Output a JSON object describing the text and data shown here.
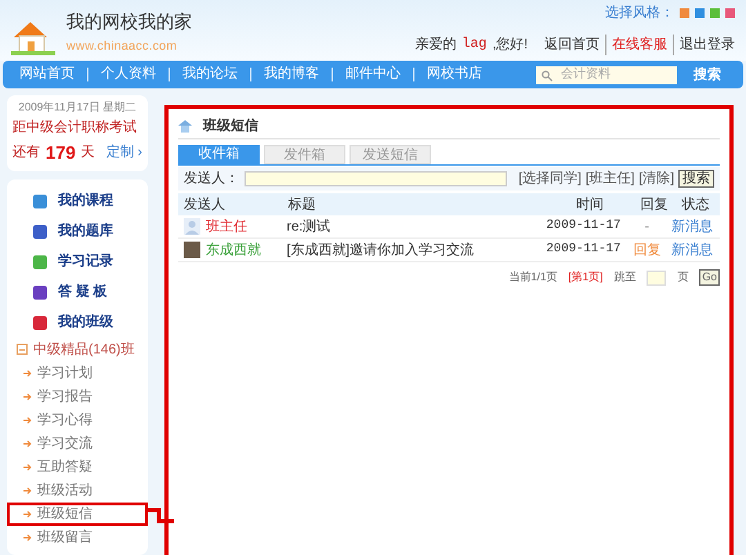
{
  "header": {
    "logo_title": "我的网校我的家",
    "logo_url": "www.chinaacc.com",
    "style_label": "选择风格：",
    "styles": [
      {
        "color": "#f08a3c",
        "selected": false
      },
      {
        "color": "#2f8fe0",
        "selected": false
      },
      {
        "color": "#5bbf3a",
        "selected": false
      },
      {
        "color": "#e8587a",
        "selected": false
      }
    ],
    "greeting_prefix": "亲爱的",
    "user": "lag",
    "greeting_suffix": ",您好!",
    "links": [
      {
        "label": "返回首页",
        "kind": "normal"
      },
      {
        "label": "在线客服",
        "kind": "hot"
      },
      {
        "label": "退出登录",
        "kind": "normal"
      }
    ]
  },
  "nav": {
    "items": [
      "网站首页",
      "个人资料",
      "我的论坛",
      "我的博客",
      "邮件中心",
      "网校书店"
    ],
    "search": {
      "placeholder": "会计资料",
      "button": "搜索"
    }
  },
  "sidebar": {
    "date": "2009年11月17日 星期二",
    "exam": "距中级会计职称考试",
    "remain_prefix": "还有",
    "days": "179",
    "remain_suffix": "天",
    "custom_link": "定制 ›",
    "menu": [
      {
        "label": "我的课程",
        "color": "#3a8fd8"
      },
      {
        "label": "我的题库",
        "color": "#3d5fc8"
      },
      {
        "label": "学习记录",
        "color": "#4cb648"
      },
      {
        "label": "答 疑 板",
        "color": "#6a3fc0"
      },
      {
        "label": "我的班级",
        "color": "#d8283a"
      }
    ],
    "class_tree": {
      "label": "中级精品(146)班",
      "expanded": true,
      "children": [
        {
          "label": "学习计划",
          "selected": false
        },
        {
          "label": "学习报告",
          "selected": false
        },
        {
          "label": "学习心得",
          "selected": false
        },
        {
          "label": "学习交流",
          "selected": false
        },
        {
          "label": "互助答疑",
          "selected": false
        },
        {
          "label": "班级活动",
          "selected": false
        },
        {
          "label": "班级短信",
          "selected": true
        },
        {
          "label": "班级留言",
          "selected": false
        }
      ]
    }
  },
  "panel": {
    "title": "班级短信",
    "tabs": [
      {
        "label": "收件箱",
        "selected": true
      },
      {
        "label": "发件箱",
        "selected": false
      },
      {
        "label": "发送短信",
        "selected": false
      }
    ],
    "filter": {
      "label": "发送人：",
      "links": [
        "[选择同学]",
        "[班主任]",
        "[清除]"
      ],
      "button": "搜索"
    },
    "table": {
      "columns": [
        "发送人",
        "标题",
        "时间",
        "回复",
        "状态"
      ],
      "rows": [
        {
          "has_photo": false,
          "sender": "班主任",
          "color": "#e0282e",
          "title": "re:测试",
          "time": "2009-11-17",
          "reply": "-",
          "reply_link": false,
          "status": "新消息"
        },
        {
          "has_photo": true,
          "sender": "东成西就",
          "color": "#3aa03a",
          "title": "[东成西就]邀请你加入学习交流",
          "time": "2009-11-17",
          "reply": "回复",
          "reply_link": true,
          "status": "新消息"
        }
      ]
    },
    "pager": {
      "current": "当前1/1页",
      "page": "[第1页]",
      "jump": "跳至",
      "unit": "页",
      "button": "Go"
    }
  }
}
